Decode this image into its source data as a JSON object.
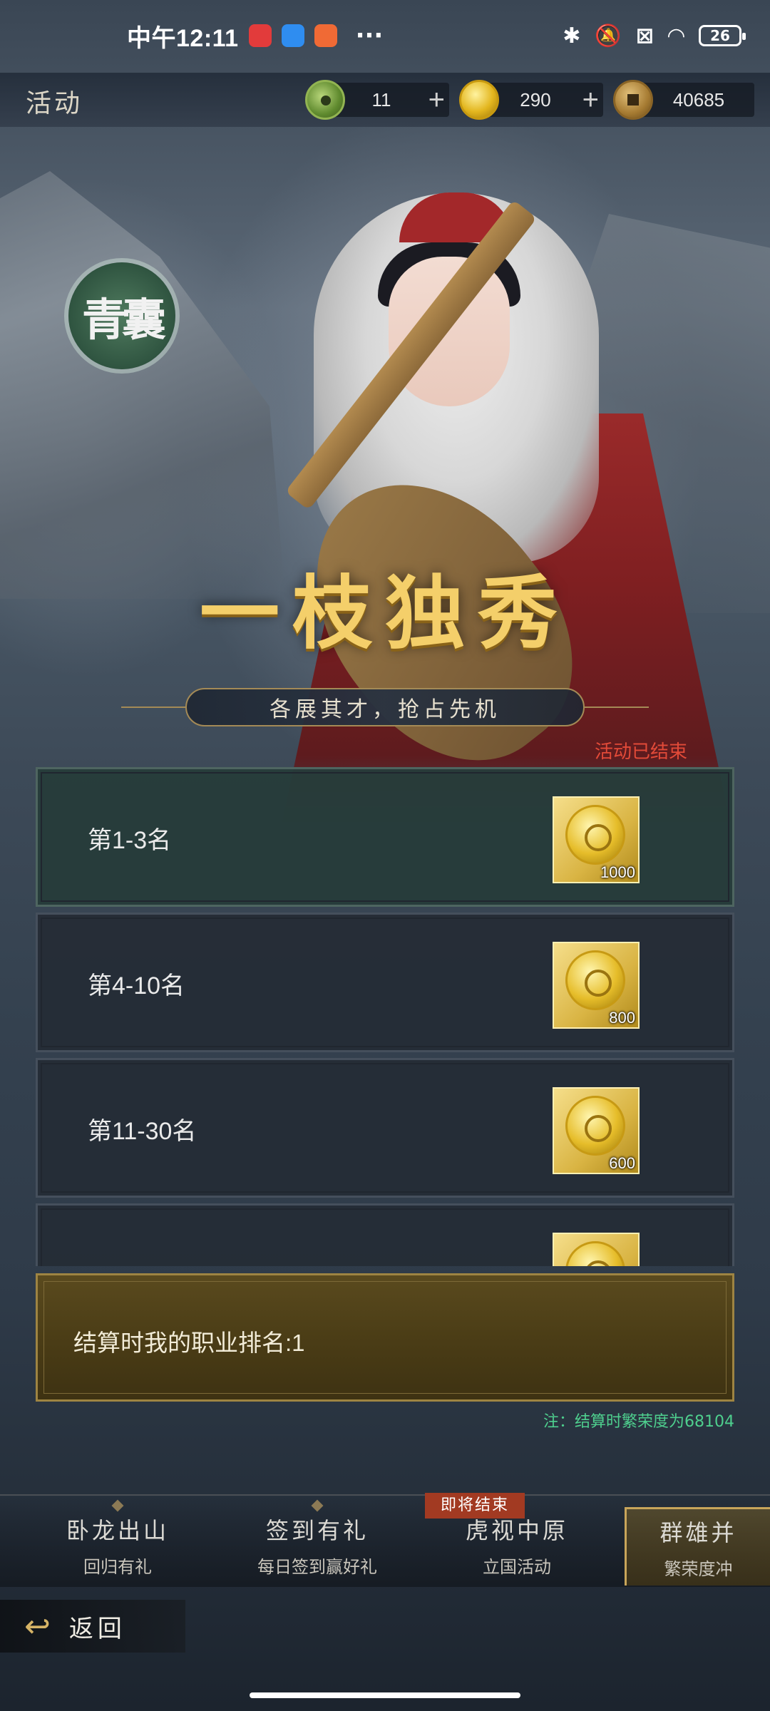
{
  "status_bar": {
    "time": "中午12:11",
    "more": "···",
    "battery": "26"
  },
  "topbar": {
    "title": "活动",
    "resources": [
      {
        "icon": "jade-token-icon",
        "value": "11",
        "plus": "+"
      },
      {
        "icon": "gold-coin-icon",
        "value": "290",
        "plus": "+"
      },
      {
        "icon": "copper-coin-icon",
        "value": "40685"
      }
    ]
  },
  "logo": {
    "text": "青囊"
  },
  "banner": {
    "title": "一枝独秀",
    "subtitle": "各展其才，抢占先机"
  },
  "event_status": "活动已结束",
  "rewards": [
    {
      "rank": "第1-3名",
      "item": "gold-coin-icon",
      "qty": "1000"
    },
    {
      "rank": "第4-10名",
      "item": "gold-coin-icon",
      "qty": "800"
    },
    {
      "rank": "第11-30名",
      "item": "gold-coin-icon",
      "qty": "600"
    },
    {
      "rank": "",
      "item": "gold-coin-icon",
      "qty": ""
    }
  ],
  "my_rank": {
    "label": "结算时我的职业排名:1"
  },
  "note": "注：结算时繁荣度为68104",
  "tabs": [
    {
      "title": "卧龙出山",
      "subtitle": "回归有礼"
    },
    {
      "title": "签到有礼",
      "subtitle": "每日签到赢好礼"
    },
    {
      "title": "虎视中原",
      "subtitle": "立国活动",
      "badge": "即将结束"
    },
    {
      "title": "群雄并",
      "subtitle": "繁荣度冲"
    }
  ],
  "back": {
    "label": "返回"
  },
  "colors": {
    "event_ended": "#e24a38",
    "note": "#4ecf8e",
    "gold_title": "#f4cf6a",
    "badge": "#a23a22"
  }
}
